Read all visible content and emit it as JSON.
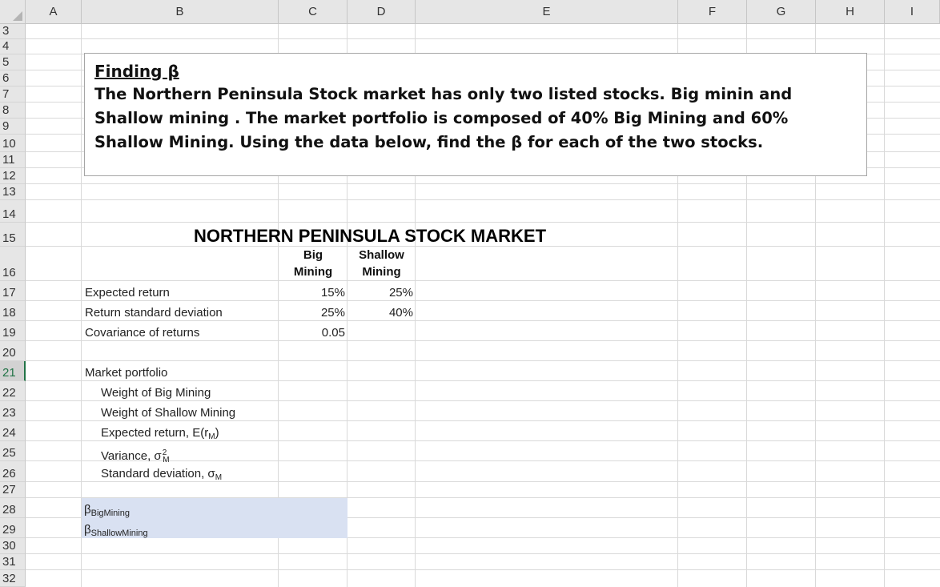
{
  "columns": [
    "A",
    "B",
    "C",
    "D",
    "E",
    "F",
    "G",
    "H",
    "I"
  ],
  "rows": [
    "3",
    "4",
    "5",
    "6",
    "7",
    "8",
    "9",
    "10",
    "11",
    "12",
    "13",
    "14",
    "15",
    "16",
    "17",
    "18",
    "19",
    "20",
    "21",
    "22",
    "23",
    "24",
    "25",
    "26",
    "27",
    "28",
    "29",
    "30",
    "31",
    "32"
  ],
  "active_row": "21",
  "textbox": {
    "title": "Finding β",
    "body": "The Northern Peninsula Stock market has only two listed stocks. Big minin and Shallow mining . The market portfolio is composed of 40% Big Mining and 60% Shallow Mining. Using the data below, find the β for each of the two stocks."
  },
  "table": {
    "title": "NORTHERN PENINSULA STOCK MARKET",
    "col_c_header": [
      "Big",
      "Mining"
    ],
    "col_d_header": [
      "Shallow",
      "Mining"
    ],
    "rows": [
      {
        "label": "Expected return",
        "c": "15%",
        "d": "25%"
      },
      {
        "label": "Return standard deviation",
        "c": "25%",
        "d": "40%"
      },
      {
        "label": "Covariance of returns",
        "c": "0.05",
        "d": ""
      }
    ]
  },
  "market": {
    "label": "Market portfolio",
    "weight_big": "Weight of Big Mining",
    "weight_shallow": "Weight of Shallow Mining",
    "expected_return": "Expected return, E(r",
    "expected_return_sub": "M",
    "expected_return_close": ")",
    "variance": "Variance, σ",
    "variance_sup": "2",
    "variance_sub": "M",
    "stdev": "Standard deviation, σ",
    "stdev_sub": "M"
  },
  "betas": {
    "beta1": "β",
    "beta1_sub": "BigMining",
    "beta2": "β",
    "beta2_sub": "ShallowMining",
    "highlight_color": "#d9e1f2"
  }
}
